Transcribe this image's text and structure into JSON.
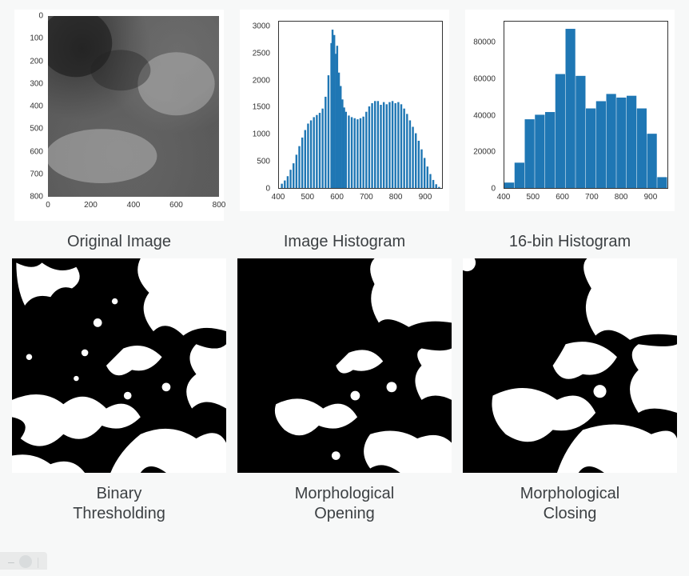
{
  "captions": {
    "top_left": "Original Image",
    "top_mid": "Image Histogram",
    "top_right": "16-bin Histogram",
    "bot_left": "Binary\nThresholding",
    "bot_mid": "Morphological\nOpening",
    "bot_right": "Morphological\nClosing"
  },
  "image_axes": {
    "x_ticks": [
      "0",
      "200",
      "400",
      "600",
      "800"
    ],
    "y_ticks": [
      "0",
      "100",
      "200",
      "300",
      "400",
      "500",
      "600",
      "700",
      "800"
    ],
    "x_range": [
      0,
      800
    ],
    "y_range": [
      0,
      800
    ]
  },
  "hist_fine_axes": {
    "x_ticks": [
      "400",
      "500",
      "600",
      "700",
      "800",
      "900"
    ],
    "y_ticks": [
      "0",
      "500",
      "1000",
      "1500",
      "2000",
      "2500",
      "3000"
    ],
    "x_range": [
      400,
      960
    ],
    "y_range": [
      0,
      3100
    ]
  },
  "hist_16_axes": {
    "x_ticks": [
      "400",
      "500",
      "600",
      "700",
      "800",
      "900"
    ],
    "y_ticks": [
      "0",
      "20000",
      "40000",
      "60000",
      "80000"
    ],
    "x_range": [
      400,
      960
    ],
    "y_range": [
      0,
      92000
    ]
  },
  "chart_data": [
    {
      "type": "heatmap",
      "name": "Original Image (grayscale satellite/cloud image)",
      "title": "",
      "xlabel": "",
      "ylabel": "",
      "x_range": [
        0,
        800
      ],
      "y_range": [
        0,
        800
      ],
      "note": "grayscale intensity image, pixel values approx 400–960"
    },
    {
      "type": "bar",
      "name": "Image Histogram",
      "title": "",
      "xlabel": "",
      "ylabel": "",
      "x_range": [
        400,
        960
      ],
      "y_range": [
        0,
        3100
      ],
      "x_label_ticks": [
        400,
        500,
        600,
        700,
        800,
        900
      ],
      "y_label_ticks": [
        0,
        500,
        1000,
        1500,
        2000,
        2500,
        3000
      ],
      "x": [
        410,
        420,
        430,
        440,
        450,
        460,
        470,
        480,
        490,
        500,
        510,
        520,
        530,
        540,
        550,
        560,
        570,
        580,
        584,
        590,
        596,
        600,
        606,
        612,
        618,
        624,
        630,
        640,
        650,
        660,
        670,
        680,
        690,
        700,
        710,
        720,
        730,
        740,
        750,
        760,
        770,
        780,
        790,
        800,
        810,
        820,
        830,
        840,
        850,
        860,
        870,
        880,
        890,
        900,
        910,
        920,
        930,
        940,
        950
      ],
      "values": [
        80,
        140,
        220,
        340,
        460,
        620,
        780,
        940,
        1080,
        1200,
        1260,
        1320,
        1360,
        1400,
        1480,
        1700,
        2100,
        2700,
        2950,
        2850,
        2500,
        2650,
        2150,
        1900,
        1650,
        1500,
        1420,
        1350,
        1320,
        1300,
        1280,
        1300,
        1330,
        1420,
        1520,
        1580,
        1620,
        1620,
        1550,
        1600,
        1560,
        1600,
        1620,
        1580,
        1600,
        1560,
        1480,
        1380,
        1260,
        1140,
        1020,
        880,
        720,
        560,
        400,
        260,
        150,
        70,
        20
      ],
      "color": "#1f77b4"
    },
    {
      "type": "bar",
      "name": "16-bin Histogram",
      "title": "",
      "xlabel": "",
      "ylabel": "",
      "x_range": [
        400,
        960
      ],
      "y_range": [
        0,
        92000
      ],
      "x_label_ticks": [
        400,
        500,
        600,
        700,
        800,
        900
      ],
      "y_label_ticks": [
        0,
        20000,
        40000,
        60000,
        80000
      ],
      "categories": [
        400,
        435,
        470,
        505,
        540,
        575,
        610,
        645,
        680,
        715,
        750,
        785,
        820,
        855,
        890,
        925
      ],
      "bin_width": 35,
      "values": [
        3000,
        14000,
        38000,
        40500,
        42000,
        63000,
        88000,
        62000,
        44000,
        48000,
        52000,
        50000,
        51000,
        44000,
        30000,
        6000
      ],
      "color": "#1f77b4"
    },
    {
      "type": "heatmap",
      "name": "Binary Thresholding",
      "note": "binary mask (0/1) from thresholding the original image",
      "values_domain": [
        0,
        1
      ]
    },
    {
      "type": "heatmap",
      "name": "Morphological Opening",
      "note": "binary mask after morphological opening",
      "values_domain": [
        0,
        1
      ]
    },
    {
      "type": "heatmap",
      "name": "Morphological Closing",
      "note": "binary mask after morphological closing",
      "values_domain": [
        0,
        1
      ]
    }
  ],
  "colors": {
    "bar": "#1f77b4",
    "axis": "#333333",
    "bg": "#f7f8f8"
  }
}
